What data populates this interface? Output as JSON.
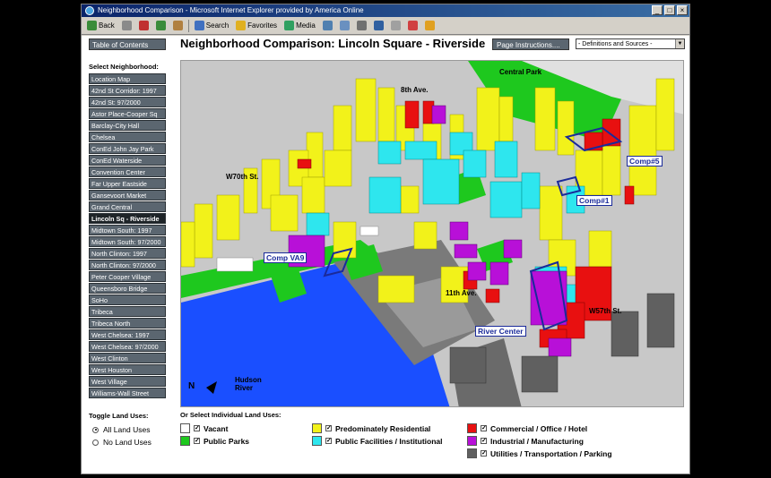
{
  "browser": {
    "title": "Neighborhood Comparison - Microsoft Internet Explorer provided by America Online",
    "toolbar": {
      "back": "Back",
      "search": "Search",
      "favorites": "Favorites",
      "media": "Media"
    }
  },
  "header": {
    "toc": "Table of Contents",
    "title": "Neighborhood Comparison: Lincoln Square - Riverside",
    "page_instructions": "Page Instructions....",
    "defs_select": "- Definitions and Sources -"
  },
  "sidebar": {
    "title": "Select Neighborhood:",
    "items": [
      "Location Map",
      "42nd St Corridor: 1997",
      "42nd St: 97/2000",
      "Astor Place-Cooper Sq",
      "Barclay-City Hall",
      "Chelsea",
      "ConEd John Jay Park",
      "ConEd Waterside",
      "Convention Center",
      "Far Upper Eastside",
      "Gansevoort Market",
      "Grand Central",
      "Lincoln Sq - Riverside",
      "Midtown South: 1997",
      "Midtown South: 97/2000",
      "North Clinton: 1997",
      "North Clinton: 97/2000",
      "Peter Cooper Village",
      "Queensboro Bridge",
      "SoHo",
      "Tribeca",
      "Tribeca North",
      "West Chelsea: 1997",
      "West Chelsea: 97/2000",
      "West Clinton",
      "West Houston",
      "West Village",
      "Williams-Wall Street"
    ],
    "selected_index": 12,
    "toggle_title": "Toggle Land Uses:",
    "toggle_all": "All Land Uses",
    "toggle_none": "No Land Uses"
  },
  "map": {
    "labels": {
      "central_park": "Central Park",
      "eighth_ave": "8th Ave.",
      "w70": "W70th St.",
      "eleventh_ave": "11th Ave.",
      "w57": "W57th St.",
      "hudson": "Hudson River",
      "north": "N"
    },
    "comps": {
      "comp5": "Comp#5",
      "comp1": "Comp#1",
      "compva9": "Comp VA9",
      "river_center": "River Center"
    }
  },
  "legend": {
    "title": "Or Select Individual Land Uses:",
    "items": [
      {
        "label": "Vacant",
        "color": "#ffffff"
      },
      {
        "label": "Public Parks",
        "color": "#1ec81e"
      },
      {
        "label": "Predominately Residential",
        "color": "#f2f21a"
      },
      {
        "label": "Public Facilities / Institutional",
        "color": "#2ee6ee"
      },
      {
        "label": "Commercial / Office / Hotel",
        "color": "#e81010"
      },
      {
        "label": "Industrial / Manufacturing",
        "color": "#b810d8"
      },
      {
        "label": "Utilities / Transportation / Parking",
        "color": "#606060"
      }
    ]
  }
}
